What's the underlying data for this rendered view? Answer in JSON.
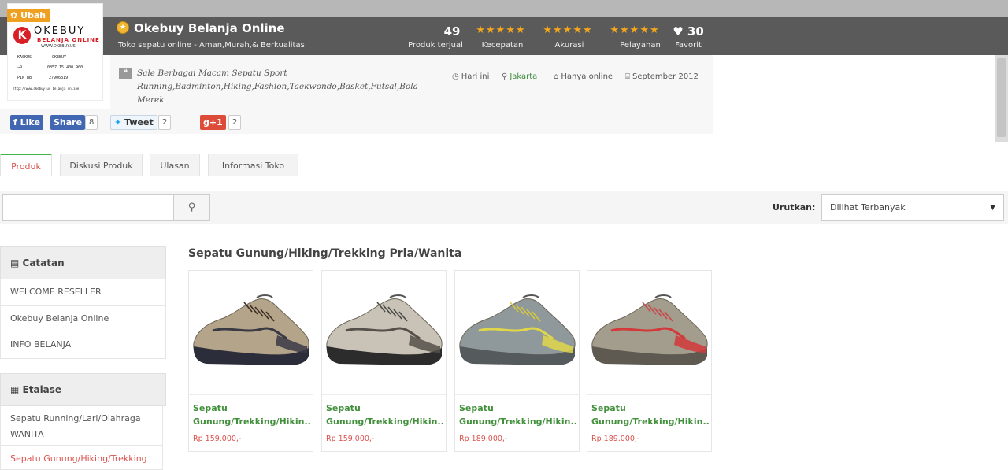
{
  "store": {
    "edit_label": "Ubah",
    "logo": {
      "letter": "K",
      "brand": "OKEBUY",
      "sub": "BELANJA ONLINE",
      "url": "WWW.OKEBUY.US",
      "lines": [
        {
          "k": "KASKUS",
          "v": "OKEBUY"
        },
        {
          "k": "→9",
          "v": "0857.15.400.900"
        },
        {
          "k": "PIN BB",
          "v": "27906819"
        }
      ],
      "fine": "http://www.okebuy.us belanja online"
    },
    "name": "Okebuy Belanja Online",
    "tagline": "Toko sepatu online - Aman,Murah,& Berkualitas",
    "stats": {
      "sold_count": "49",
      "sold_label": "Produk terjual",
      "speed_label": "Kecepatan",
      "accuracy_label": "Akurasi",
      "service_label": "Pelayanan",
      "stars": "★★★★★",
      "fav_count": "30",
      "fav_label": "Favorit"
    },
    "description": "Sale Berbagai Macam Sepatu Sport Running,Badminton,Hiking,Fashion,Taekwondo,Basket,Futsal,Bola Merek",
    "meta": {
      "today": "Hari ini",
      "location": "Jakarta",
      "online": "Hanya online",
      "since": "September 2012"
    }
  },
  "social": {
    "like": "Like",
    "share": "Share",
    "share_count": "8",
    "tweet": "Tweet",
    "tweet_count": "2",
    "gplus": "+1",
    "gplus_count": "2"
  },
  "tabs": [
    {
      "label": "Produk"
    },
    {
      "label": "Diskusi Produk"
    },
    {
      "label": "Ulasan"
    },
    {
      "label": "Informasi Toko"
    }
  ],
  "search": {
    "placeholder": "",
    "sort_label": "Urutkan:",
    "sort_value": "Dilihat Terbanyak"
  },
  "sidebar": {
    "notes_title": "Catatan",
    "notes": [
      "WELCOME RESELLER",
      "Okebuy Belanja Online",
      "INFO BELANJA"
    ],
    "showcase_title": "Etalase",
    "showcase": [
      "Sepatu Running/Lari/Olahraga WANITA",
      "Sepatu Gunung/Hiking/Trekking"
    ]
  },
  "section_title": "Sepatu Gunung/Hiking/Trekking Pria/Wanita",
  "products": [
    {
      "name": "Sepatu Gunung/Trekking/Hikin...",
      "price": "Rp 159.000,-",
      "upper": "#b4a48a",
      "accent": "#3a3a45",
      "sole": "#2b2d3a",
      "lace": "#3a2e22"
    },
    {
      "name": "Sepatu Gunung/Trekking/Hikin...",
      "price": "Rp 159.000,-",
      "upper": "#c9c3b7",
      "accent": "#55514a",
      "sole": "#2c2c2c",
      "lace": "#4a4a4a"
    },
    {
      "name": "Sepatu Gunung/Trekking/Hikin...",
      "price": "Rp 189.000,-",
      "upper": "#8f989a",
      "accent": "#e0d64a",
      "sole": "#555a5c",
      "lace": "#d8c93c"
    },
    {
      "name": "Sepatu Gunung/Trekking/Hikin...",
      "price": "Rp 189.000,-",
      "upper": "#a39d8e",
      "accent": "#d2393a",
      "sole": "#5e5a52",
      "lace": "#c8484a"
    }
  ]
}
